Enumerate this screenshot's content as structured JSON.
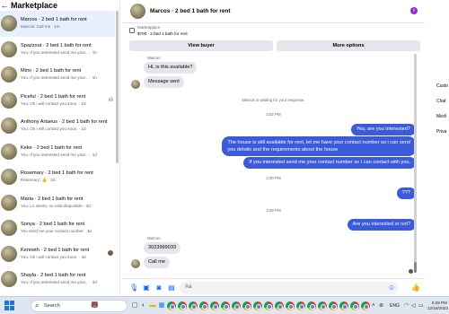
{
  "sidebar": {
    "title": "Marketplace",
    "conversations": [
      {
        "title": "Marcos · 2 bed 1 bath for rent",
        "preview": "Marcos: Call me · 1m",
        "active": true
      },
      {
        "title": "Spazzout · 2 bed 1 bath for rent",
        "preview": "You: If you interested send me your... · 1h"
      },
      {
        "title": "Mimi · 2 bed 1 bath for rent",
        "preview": "You: If you interested send me your... · 1h"
      },
      {
        "title": "Piceful · 2 bed 1 bath for rent",
        "preview": "You: Ok i will contact you soon. · 1d"
      },
      {
        "title": "Anthony Artaeus · 2 bed 1 bath for rent",
        "preview": "You: Ok i will contact you soon. · 1d"
      },
      {
        "title": "Keke · 2 bed 1 bath for rent",
        "preview": "You: If you interested send me your... · 1d"
      },
      {
        "title": "Rosemary · 2 bed 1 bath for rent",
        "preview": "Rosemary: 👍 · 2d"
      },
      {
        "title": "Maria · 2 bed 1 bath for rent",
        "preview": "You: Lo siento, no está disponible · 3d"
      },
      {
        "title": "Sonya · 2 bed 1 bath for rent",
        "preview": "You send me your contact number · 3d"
      },
      {
        "title": "Kenneth · 2 bed 1 bath for rent",
        "preview": "You: Ok i will contact you soon. · 3d"
      },
      {
        "title": "Shayla · 2 bed 1 bath for rent",
        "preview": "You: If you interested send me your... · 3d"
      }
    ]
  },
  "chat": {
    "header_title": "Marcos · 2 bed 1 bath for rent",
    "marketplace_label": "Marketplace",
    "listing": "$700 · 2 bed 1 bath for rent",
    "view_buyer_label": "View buyer",
    "more_options_label": "More options",
    "messages": {
      "sender_top": "Marcos",
      "in1": "Hi, is this available?",
      "in2": "Message sent",
      "system": "Marcos is waiting for your response.",
      "time1": "2:02 PM",
      "out1": "Yes, are you interested?",
      "out2a": "The house is still available for rent, let me have your contact number so i can send",
      "out2b": "you details and the requirements about the house",
      "out3": "If you interested send me your contact number so I can contact with you.",
      "time2": "2:30 PM",
      "out4": "???",
      "time3": "3:28 PM",
      "out5": "Are you interested or not?",
      "sender_bottom": "Marcos",
      "in3": "3023999033",
      "in4": "Call me"
    },
    "composer_placeholder": "Aa"
  },
  "right_panel": {
    "items": [
      "Custo",
      "Chat",
      "Medi",
      "Priva"
    ]
  },
  "taskbar": {
    "search_label": "Search",
    "tray_lang": "ENG",
    "time": "8:29 PM",
    "date": "12/18/2023"
  },
  "colors": {
    "accent_blue": "#3b5bdb",
    "incoming_bubble": "#e4e6eb",
    "active_row": "#e7f0fd",
    "notification_purple": "#9b27d6"
  }
}
